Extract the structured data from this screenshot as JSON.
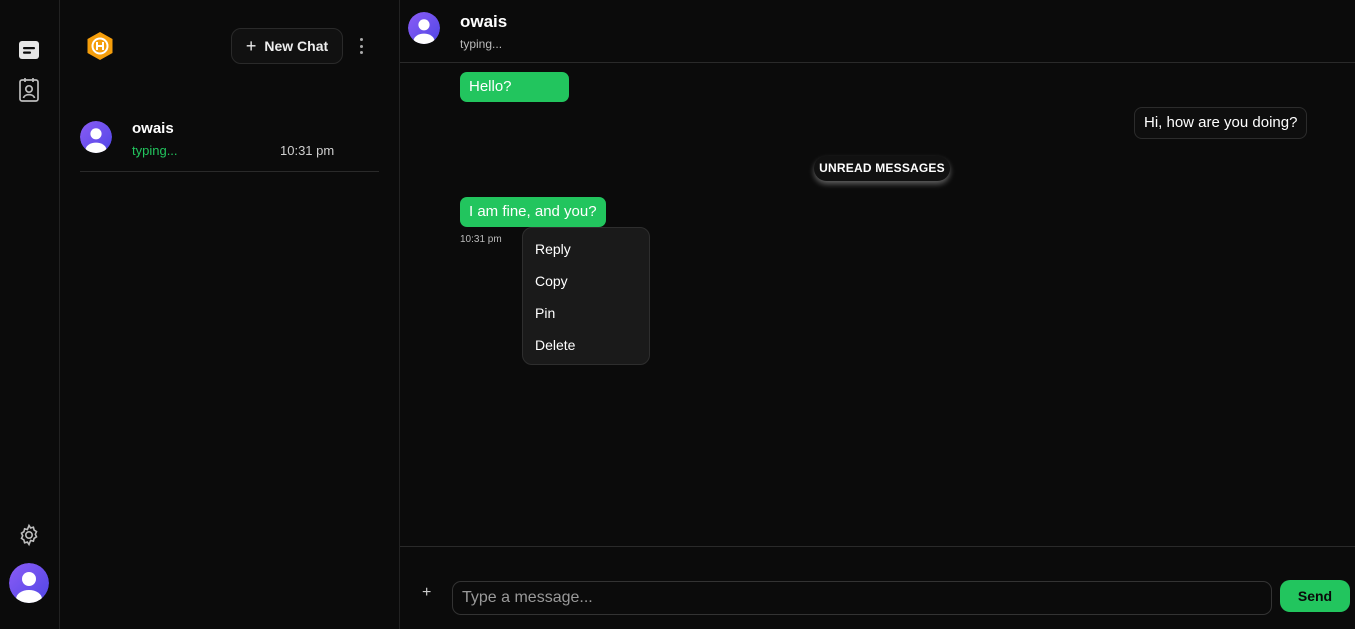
{
  "sidebar": {
    "new_chat_label": "New Chat",
    "chats": [
      {
        "name": "owais",
        "status": "typing...",
        "time": "10:31 pm"
      }
    ]
  },
  "conversation": {
    "contact_name": "owais",
    "contact_status": "typing...",
    "messages": [
      {
        "text": "Hello?",
        "direction": "incoming"
      },
      {
        "text": "Hi, how are you doing?",
        "direction": "outgoing"
      },
      {
        "text": "I am fine, and you?",
        "direction": "incoming",
        "time": "10:31 pm"
      }
    ],
    "unread_divider": "UNREAD MESSAGES"
  },
  "context_menu": {
    "items": [
      "Reply",
      "Copy",
      "Pin",
      "Delete"
    ]
  },
  "composer": {
    "placeholder": "Type a message...",
    "attach_icon": "+",
    "send_label": "Send"
  },
  "icons": {
    "rail": [
      "chats-icon",
      "contacts-icon",
      "settings-icon"
    ],
    "logo": "app-logo-icon"
  },
  "colors": {
    "background": "#0b0b0b",
    "accent": "#22c55e",
    "avatar": "#7c3aed",
    "logo": "#f59e0b"
  }
}
